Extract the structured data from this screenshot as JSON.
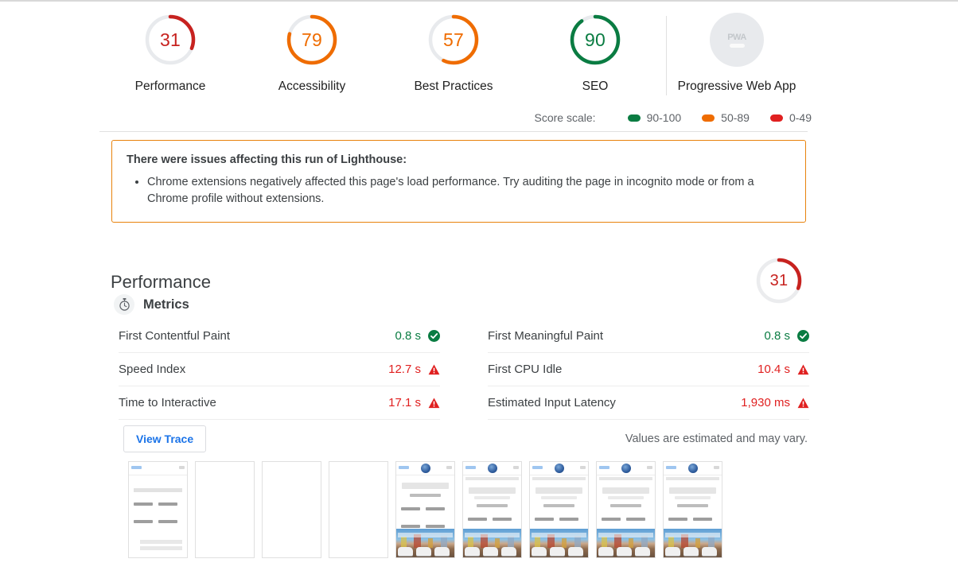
{
  "gauges": [
    {
      "score": "31",
      "label": "Performance",
      "color": "#c7221f",
      "pct": 31
    },
    {
      "score": "79",
      "label": "Accessibility",
      "color": "#ef6c00",
      "pct": 79
    },
    {
      "score": "57",
      "label": "Best Practices",
      "color": "#ef6c00",
      "pct": 57
    },
    {
      "score": "90",
      "label": "SEO",
      "color": "#0a7c42",
      "pct": 90
    }
  ],
  "pwa": {
    "badge_text": "PWA",
    "label": "Progressive Web App"
  },
  "score_scale": {
    "label": "Score scale:",
    "items": [
      {
        "range": "90-100",
        "color": "#0a7c42"
      },
      {
        "range": "50-89",
        "color": "#ef6c00"
      },
      {
        "range": "0-49",
        "color": "#e02020"
      }
    ]
  },
  "warning": {
    "title": "There were issues affecting this run of Lighthouse:",
    "items": [
      "Chrome extensions negatively affected this page's load performance. Try auditing the page in incognito mode or from a Chrome profile without extensions."
    ],
    "border_color": "#e8820c"
  },
  "performance_section": {
    "title": "Performance",
    "score": "31",
    "score_color": "#c7221f",
    "score_pct": 31,
    "metrics_heading": "Metrics",
    "metrics_icon": "stopwatch-icon",
    "metrics_left": [
      {
        "name": "First Contentful Paint",
        "value": "0.8 s",
        "status": "pass"
      },
      {
        "name": "Speed Index",
        "value": "12.7 s",
        "status": "fail"
      },
      {
        "name": "Time to Interactive",
        "value": "17.1 s",
        "status": "fail"
      }
    ],
    "metrics_right": [
      {
        "name": "First Meaningful Paint",
        "value": "0.8 s",
        "status": "pass"
      },
      {
        "name": "First CPU Idle",
        "value": "10.4 s",
        "status": "fail"
      },
      {
        "name": "Estimated Input Latency",
        "value": "1,930 ms",
        "status": "fail"
      }
    ],
    "view_trace_label": "View Trace",
    "values_note": "Values are estimated and may vary.",
    "filmstrip": [
      {
        "state": "text"
      },
      {
        "state": "blank"
      },
      {
        "state": "blank"
      },
      {
        "state": "blank"
      },
      {
        "state": "loaded"
      },
      {
        "state": "loaded"
      },
      {
        "state": "loaded"
      },
      {
        "state": "loaded"
      },
      {
        "state": "loaded"
      }
    ]
  },
  "colors": {
    "pass": "#0a7c42",
    "fail": "#e02020",
    "average": "#ef6c00",
    "link": "#1a73e8"
  }
}
